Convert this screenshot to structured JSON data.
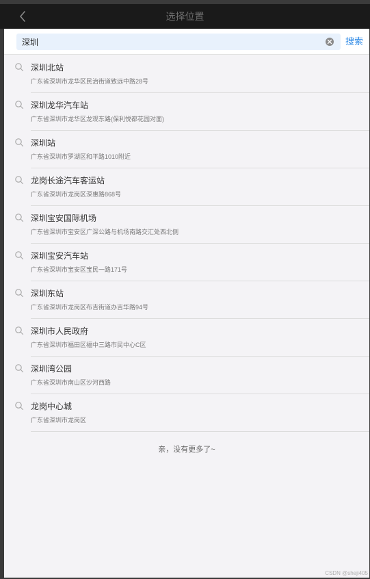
{
  "header": {
    "title": "选择位置",
    "back_icon": "chevron-left-icon"
  },
  "search": {
    "value": "深圳",
    "placeholder": "",
    "clear_icon": "clear-icon",
    "button_label": "搜索"
  },
  "results": [
    {
      "name": "深圳北站",
      "address": "广东省深圳市龙华区民治街道致远中路28号"
    },
    {
      "name": "深圳龙华汽车站",
      "address": "广东省深圳市龙华区龙观东路(保利悦都花园对面)"
    },
    {
      "name": "深圳站",
      "address": "广东省深圳市罗湖区和平路1010附近"
    },
    {
      "name": "龙岗长途汽车客运站",
      "address": "广东省深圳市龙岗区深惠路868号"
    },
    {
      "name": "深圳宝安国际机场",
      "address": "广东省深圳市宝安区广深公路与机场南路交汇处西北侧"
    },
    {
      "name": "深圳宝安汽车站",
      "address": "广东省深圳市宝安区宝民一路171号"
    },
    {
      "name": "深圳东站",
      "address": "广东省深圳市龙岗区布吉街道办吉华路94号"
    },
    {
      "name": "深圳市人民政府",
      "address": "广东省深圳市福田区福中三路市民中心C区"
    },
    {
      "name": "深圳湾公园",
      "address": "广东省深圳市南山区沙河西路"
    },
    {
      "name": "龙岗中心城",
      "address": "广东省深圳市龙岗区"
    }
  ],
  "footer": {
    "no_more": "亲，没有更多了~",
    "watermark": "CSDN @sheji405"
  },
  "colors": {
    "accent": "#2f8ae6",
    "nav_bg": "#1a1a1a",
    "search_box_bg": "#e8f1fc",
    "page_bg": "#f4f3f6"
  }
}
